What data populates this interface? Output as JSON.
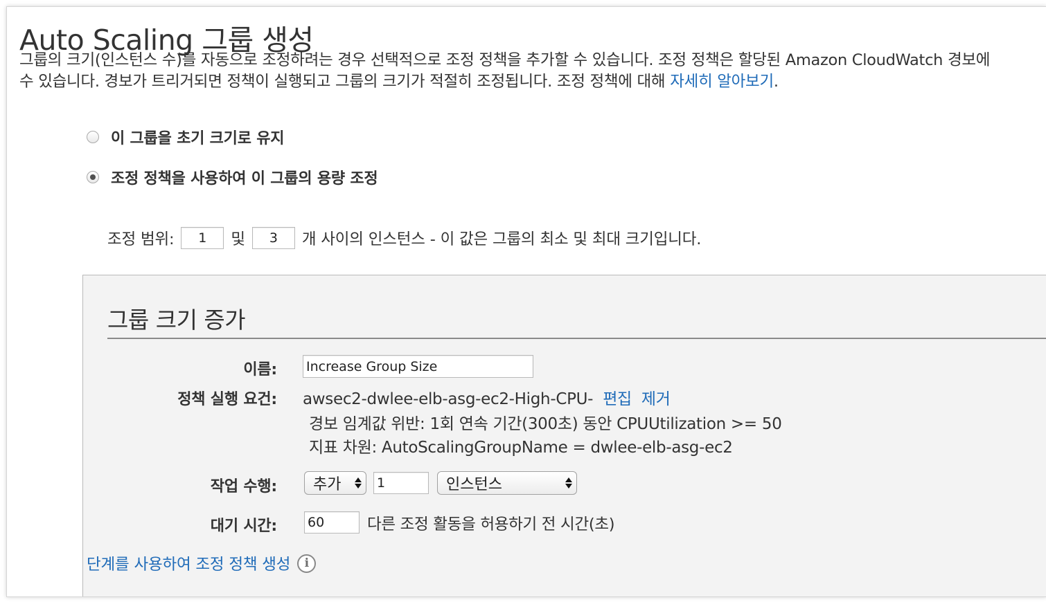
{
  "header": {
    "title": "Auto Scaling 그룹 생성",
    "description_line1": "그룹의 크기(인스턴스 수)를 자동으로 조정하려는 경우 선택적으로 조정 정책을 추가할 수 있습니다. 조정 정책은 할당된 Amazon CloudWatch 경보에",
    "description_line2": "수 있습니다. 경보가 트리거되면 정책이 실행되고 그룹의 크기가 적절히 조정됩니다. 조정 정책에 대해 ",
    "learn_more_link": "자세히 알아보기",
    "description_end": "."
  },
  "options": {
    "keep_initial_size": {
      "label": "이 그룹을 초기 크기로 유지",
      "selected": false
    },
    "use_scaling_policies": {
      "label": "조정 정책을 사용하여 이 그룹의 용량 조정",
      "selected": true
    }
  },
  "scale_range": {
    "prefix": "조정 범위:",
    "min": "1",
    "between": "및",
    "max": "3",
    "suffix": "개 사이의 인스턴스 - 이 값은 그룹의 최소 및 최대 크기입니다."
  },
  "policy_panel": {
    "title": "그룹 크기 증가",
    "name_label": "이름:",
    "name_value": "Increase Group Size",
    "execute_label": "정책 실행 요건:",
    "alarm_name": "awsec2-dwlee-elb-asg-ec2-High-CPU-",
    "edit_link": "편집",
    "remove_link": "제거",
    "alarm_breach": "경보 임계값 위반: 1회 연속 기간(300초) 동안 CPUUtilization >= 50",
    "metric_dimension": "지표 차원:  AutoScalingGroupName = dwlee-elb-asg-ec2",
    "action_label": "작업 수행:",
    "action_select": "추가",
    "action_quantity": "1",
    "action_unit_select": "인스턴스",
    "cooldown_label": "대기 시간:",
    "cooldown_value": "60",
    "cooldown_suffix": "다른 조정 활동을 허용하기 전 시간(초)"
  },
  "step_policy_link": "단계를 사용하여 조정 정책 생성",
  "icons": {
    "info": "info-icon",
    "select_arrows": "select-arrows-icon"
  },
  "colors": {
    "link": "#1f6bb8",
    "panel_background": "#f3f3f3",
    "text": "#333333"
  }
}
